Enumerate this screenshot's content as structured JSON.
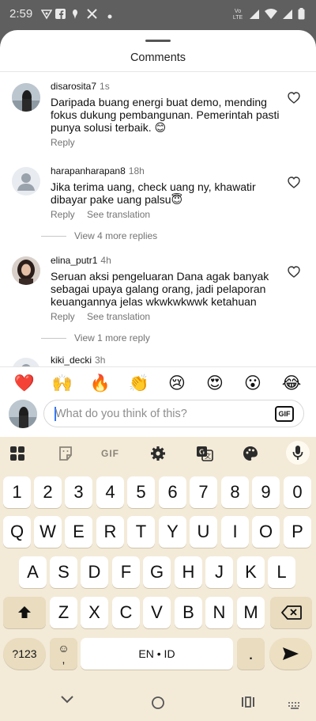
{
  "status_bar": {
    "time": "2:59",
    "network_label": "Vo LTE"
  },
  "sheet": {
    "title": "Comments"
  },
  "comments": [
    {
      "username": "disarosita7",
      "time": "1s",
      "text": "Daripada buang energi buat demo, mending fokus dukung pembangunan. Pemerintah pasti punya solusi terbaik. 😊",
      "reply": "Reply",
      "see_translation": ""
    },
    {
      "username": "harapanharapan8",
      "time": "18h",
      "text": "Jika terima uang, check uang ny, khawatir dibayar pake uang palsu😇",
      "reply": "Reply",
      "see_translation": "See translation",
      "view_more": "View 4 more replies"
    },
    {
      "username": "elina_putr1",
      "time": "4h",
      "text": "Seruan aksi pengeluaran Dana agak banyak sebagai upaya galang orang, jadi pelaporan keuangannya jelas wkwkwkwwk ketahuan",
      "reply": "Reply",
      "see_translation": "See translation",
      "view_more": "View 1 more reply"
    },
    {
      "username": "kiki_decki",
      "time": "3h"
    }
  ],
  "emoji_bar": [
    "❤️",
    "🙌",
    "🔥",
    "👏",
    "😢",
    "😍",
    "😮",
    "😂"
  ],
  "composer": {
    "placeholder": "What do you think of this?",
    "gif_label": "GIF"
  },
  "keyboard": {
    "toolbar_gif": "GIF",
    "row_numbers": [
      "1",
      "2",
      "3",
      "4",
      "5",
      "6",
      "7",
      "8",
      "9",
      "0"
    ],
    "row1": [
      "Q",
      "W",
      "E",
      "R",
      "T",
      "Y",
      "U",
      "I",
      "O",
      "P"
    ],
    "row2": [
      "A",
      "S",
      "D",
      "F",
      "G",
      "H",
      "J",
      "K",
      "L"
    ],
    "row3": [
      "Z",
      "X",
      "C",
      "V",
      "B",
      "N",
      "M"
    ],
    "symbols_key": "?123",
    "space_label": "EN • ID",
    "period": "."
  },
  "colors": {
    "status_bg": "#5f5f5f",
    "keyboard_bg": "#f3ead8",
    "special_key": "#e9dcbf",
    "caret": "#3478f6"
  }
}
